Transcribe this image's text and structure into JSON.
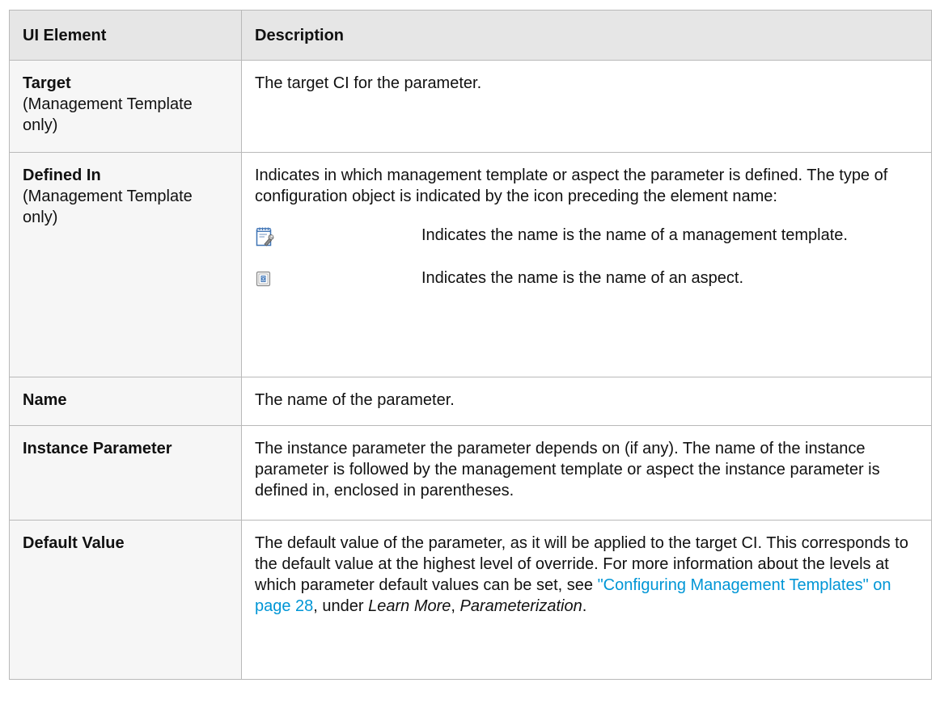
{
  "table": {
    "headers": {
      "element": "UI Element",
      "description": "Description"
    },
    "rows": [
      {
        "name": "Target",
        "note": "(Management Template only)",
        "description": "The target CI for the parameter."
      },
      {
        "name": "Defined In",
        "note": "(Management Template only)",
        "description": "Indicates in which management template or aspect the parameter is defined. The type of configuration object is indicated by the icon preceding the element name:",
        "icons": [
          {
            "icon": "management-template-icon",
            "text": "Indicates the name is the name of a management template."
          },
          {
            "icon": "aspect-icon",
            "text": "Indicates the name is the name of an aspect."
          }
        ]
      },
      {
        "name": "Name",
        "description": "The name of the parameter."
      },
      {
        "name": "Instance Parameter",
        "description": "The instance parameter the parameter depends on (if any). The name of the instance parameter is followed by the management template or aspect the instance parameter is defined in, enclosed in parentheses."
      },
      {
        "name": "Default Value",
        "description_parts": {
          "intro": "The default value of the parameter, as it will be applied to the target CI. This corresponds to the default value at the highest level of override. For more information about the levels at which parameter default values can be set, see ",
          "link": "\"Configuring Management Templates\" on page 28",
          "middle": ", under ",
          "learn_more": "Learn More",
          "comma": ",",
          "parameterization": "Parameterization",
          "end": "."
        }
      }
    ]
  },
  "colors": {
    "header_bg": "#e6e6e6",
    "element_cell_bg": "#f6f6f6",
    "border": "#b9b9b9",
    "link": "#0096d6"
  }
}
